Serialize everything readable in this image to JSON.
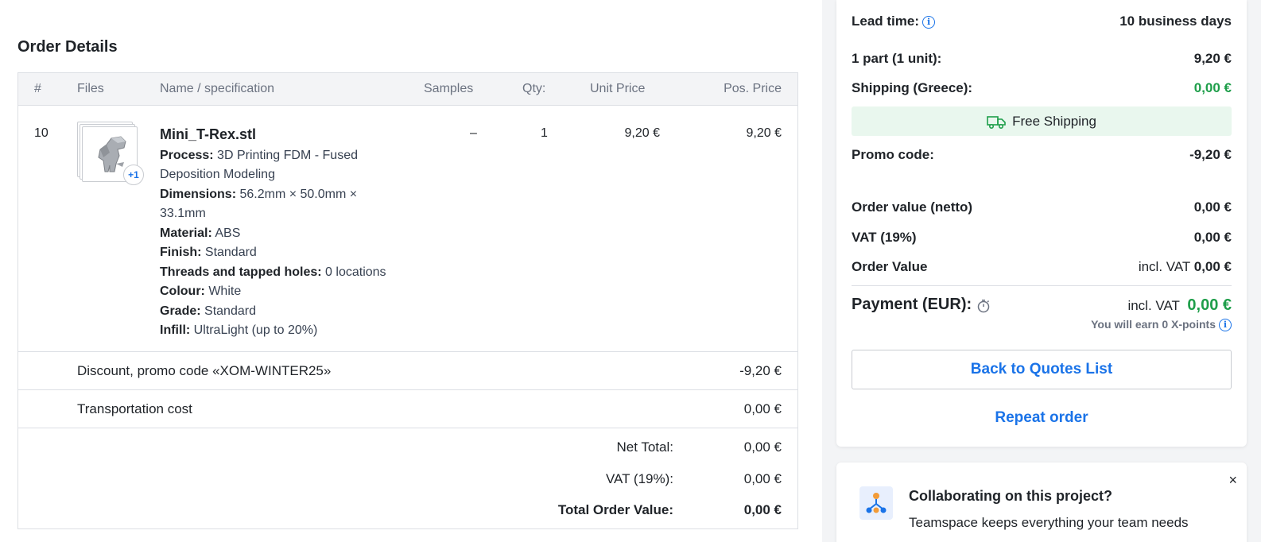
{
  "order_details": {
    "title": "Order Details",
    "columns": [
      "#",
      "Files",
      "Name / specification",
      "Samples",
      "Qty:",
      "Unit Price",
      "Pos. Price"
    ],
    "item": {
      "number": "10",
      "extra_files_badge": "+1",
      "file_name": "Mini_T-Rex.stl",
      "specs": [
        {
          "label": "Process:",
          "value": "3D Printing FDM - Fused Deposition Modeling"
        },
        {
          "label": "Dimensions:",
          "value": "56.2mm × 50.0mm × 33.1mm"
        },
        {
          "label": "Material:",
          "value": "ABS"
        },
        {
          "label": "Finish:",
          "value": "Standard"
        },
        {
          "label": "Threads and tapped holes:",
          "value": "0 locations"
        },
        {
          "label": "Colour:",
          "value": "White"
        },
        {
          "label": "Grade:",
          "value": "Standard"
        },
        {
          "label": "Infill:",
          "value": "UltraLight (up to 20%)"
        }
      ],
      "samples": "–",
      "qty": "1",
      "unit_price": "9,20 €",
      "pos_price": "9,20 €"
    },
    "discount": {
      "label": "Discount, promo code «XOM-WINTER25»",
      "value": "-9,20 €"
    },
    "transport": {
      "label": "Transportation cost",
      "value": "0,00 €"
    },
    "totals": {
      "net_label": "Net Total:",
      "net_value": "0,00 €",
      "vat_label": "VAT (19%):",
      "vat_value": "0,00 €",
      "total_label": "Total Order Value:",
      "total_value": "0,00 €"
    }
  },
  "summary": {
    "lead_time_label": "Lead time:",
    "lead_time_value": "10 business days",
    "part_label": "1 part (1 unit):",
    "part_value": "9,20 €",
    "shipping_label": "Shipping (Greece):",
    "shipping_value": "0,00 €",
    "free_shipping": "Free Shipping",
    "promo_label": "Promo code:",
    "promo_value": "-9,20 €",
    "netto_label": "Order value (netto)",
    "netto_value": "0,00 €",
    "vat_label": "VAT (19%)",
    "vat_value": "0,00 €",
    "order_value_label": "Order Value",
    "order_value_prefix": "incl. VAT",
    "order_value_value": "0,00 €",
    "payment_label": "Payment (EUR):",
    "payment_prefix": "incl. VAT",
    "payment_value": "0,00 €",
    "earn_text": "You will earn 0 X-points",
    "back_button": "Back to Quotes List",
    "repeat_button": "Repeat order"
  },
  "collab": {
    "title": "Collaborating on this project?",
    "desc": "Teamspace keeps everything your team needs",
    "close": "×"
  },
  "colors": {
    "accent": "#1a73e8",
    "success": "#1e9e4a",
    "free_ship_bg": "#e9f7ee"
  }
}
